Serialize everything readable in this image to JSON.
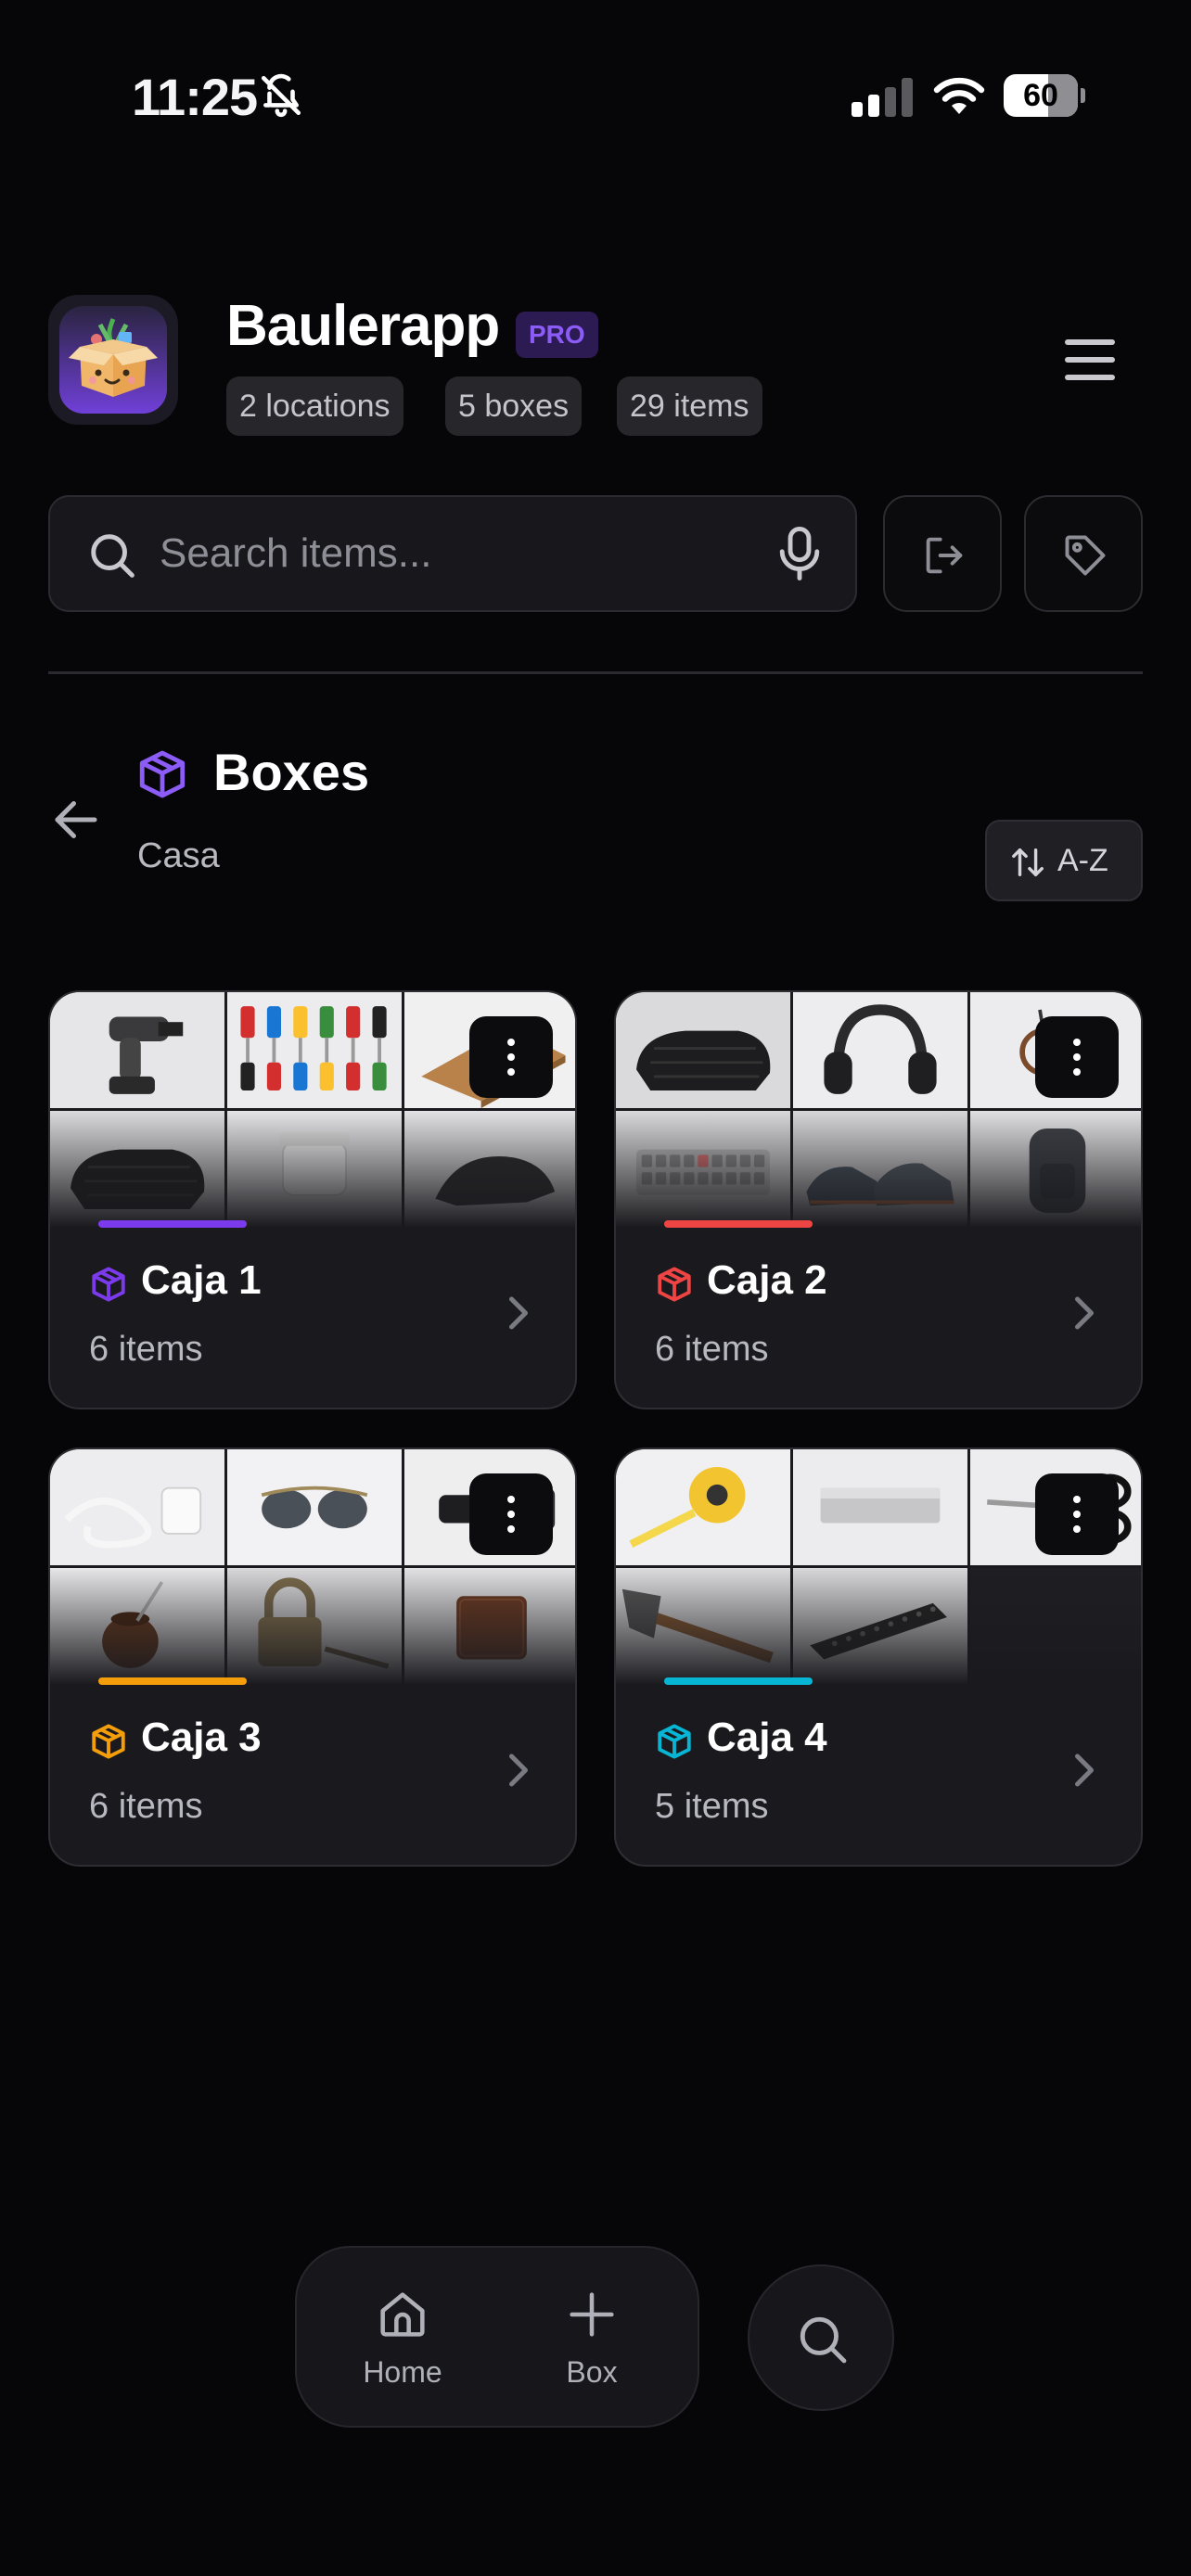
{
  "status_bar": {
    "time": "11:25",
    "battery": "60",
    "icons": [
      "bell-slash-icon",
      "signal-icon",
      "wifi-icon",
      "battery-icon"
    ]
  },
  "header": {
    "app_name": "Baulerapp",
    "badge": "PRO",
    "stats": {
      "locations": "2 locations",
      "boxes": "5 boxes",
      "items": "29 items"
    },
    "menu_icon": "hamburger-menu-icon"
  },
  "search": {
    "placeholder": "Search items...",
    "value": "",
    "icons": [
      "search-icon",
      "microphone-icon",
      "export-icon",
      "tag-icon"
    ]
  },
  "section": {
    "title": "Boxes",
    "location": "Casa",
    "sort_label": "A-Z",
    "icons": [
      "back-arrow-icon",
      "box-icon",
      "sort-arrows-icon"
    ]
  },
  "boxes": [
    {
      "name": "Caja 1",
      "count": "6 items",
      "color": "#7c3aed",
      "thumbnails": [
        "drill",
        "screwdrivers",
        "cutting-board",
        "black-jacket",
        "white-bowl",
        "black-cap"
      ]
    },
    {
      "name": "Caja 2",
      "count": "6 items",
      "color": "#ef4444",
      "thumbnails": [
        "black-jacket",
        "headphones",
        "glasses-case",
        "keyboard",
        "sneakers",
        "backpack"
      ]
    },
    {
      "name": "Caja 3",
      "count": "6 items",
      "color": "#f59e0b",
      "thumbnails": [
        "charging-cable",
        "sunglasses",
        "flashlight",
        "mate-gourd",
        "padlock",
        "wallet"
      ]
    },
    {
      "name": "Caja 4",
      "count": "5 items",
      "color": "#06b6d4",
      "thumbnails": [
        "tape-measure",
        "metal-bar",
        "scissors",
        "hammer",
        "remote-control"
      ]
    }
  ],
  "bottom_nav": {
    "home": "Home",
    "box": "Box",
    "icons": [
      "home-icon",
      "plus-icon",
      "search-icon"
    ]
  },
  "colors": {
    "background": "#060608",
    "card": "#1a1a1e",
    "accent": "#7c3aed"
  }
}
